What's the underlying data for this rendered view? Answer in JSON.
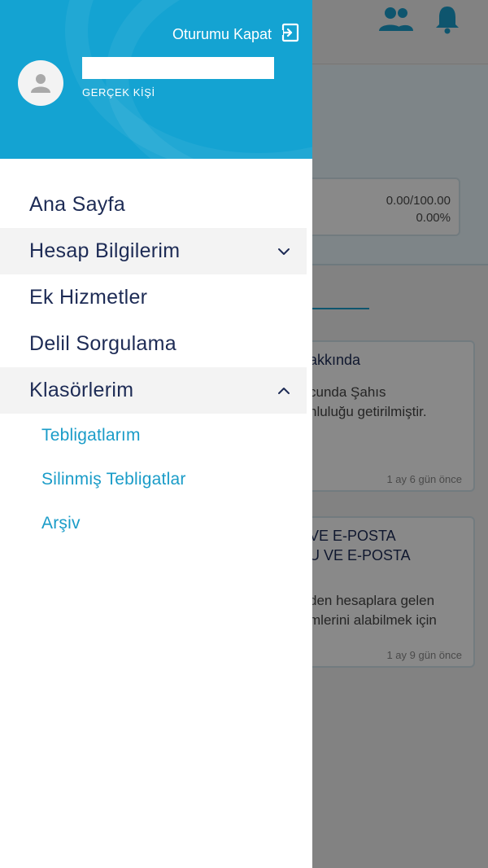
{
  "drawer": {
    "logout_label": "Oturumu Kapat",
    "person_type": "GERÇEK KİŞİ",
    "menu": [
      {
        "label": "Ana Sayfa"
      },
      {
        "label": "Hesap Bilgilerim"
      },
      {
        "label": "Ek Hizmetler"
      },
      {
        "label": "Delil Sorgulama"
      },
      {
        "label": "Klasörlerim"
      }
    ],
    "folders": [
      {
        "label": "Tebligatlarım"
      },
      {
        "label": "Silinmiş Tebligatlar"
      },
      {
        "label": "Arşiv"
      }
    ]
  },
  "background": {
    "quota_text": "0.00/100.00",
    "quota_percent": "0.00%",
    "cards": [
      {
        "title_fragment": "akkında",
        "body_line1": "cunda Şahıs",
        "body_line2": "nluluğu getirilmiştir.",
        "date": "1 ay 6 gün önce"
      },
      {
        "title_line1": "VE E-POSTA",
        "title_line2": "U VE E-POSTA",
        "body_line1": "den hesaplara gelen",
        "body_line2": "mlerini alabilmek için",
        "date": "1 ay 9 gün önce"
      }
    ]
  },
  "colors": {
    "accent": "#14a3d2",
    "menu_text": "#1d2b55",
    "submenu_text": "#1a9cc8"
  }
}
